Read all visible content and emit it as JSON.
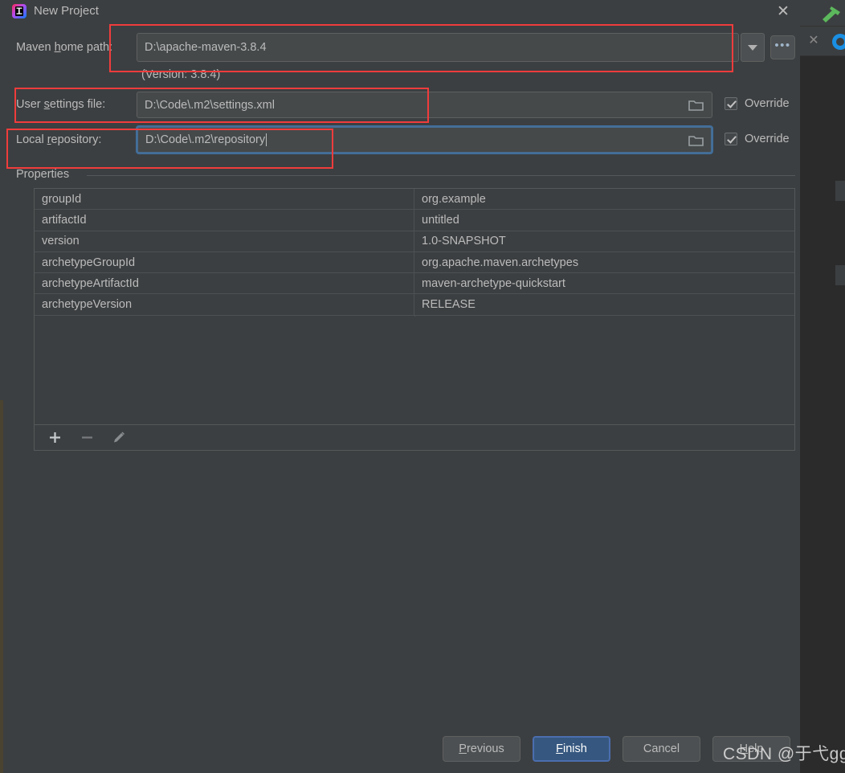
{
  "window": {
    "title": "New Project",
    "app_icon": "intellij-idea-icon",
    "close_label": "✕"
  },
  "form": {
    "maven_home": {
      "label_pre": "Maven ",
      "label_mnemonic": "h",
      "label_post": "ome path:",
      "value": "D:\\apache-maven-3.8.4",
      "dropdown_icon": "chevron-down-icon",
      "browse_label": "•••",
      "version_note": "(Version: 3.8.4)"
    },
    "user_settings": {
      "label_pre": "User ",
      "label_mnemonic": "s",
      "label_post": "ettings file:",
      "value": "D:\\Code\\.m2\\settings.xml",
      "browse_icon": "folder-icon",
      "override_label": "Override",
      "override_checked": true
    },
    "local_repository": {
      "label_pre": "Local ",
      "label_mnemonic": "r",
      "label_post": "epository:",
      "value": "D:\\Code\\.m2\\repository",
      "browse_icon": "folder-icon",
      "override_label": "Override",
      "override_checked": true,
      "focused": true
    }
  },
  "properties": {
    "section_label": "Properties",
    "rows": [
      {
        "key": "groupId",
        "value": "org.example"
      },
      {
        "key": "artifactId",
        "value": "untitled"
      },
      {
        "key": "version",
        "value": "1.0-SNAPSHOT"
      },
      {
        "key": "archetypeGroupId",
        "value": "org.apache.maven.archetypes"
      },
      {
        "key": "archetypeArtifactId",
        "value": "maven-archetype-quickstart"
      },
      {
        "key": "archetypeVersion",
        "value": "RELEASE"
      }
    ],
    "toolbar": {
      "add_icon": "plus-icon",
      "remove_icon": "minus-icon",
      "edit_icon": "pencil-icon"
    }
  },
  "footer": {
    "previous": {
      "pre": "",
      "mnemonic": "P",
      "post": "revious"
    },
    "finish": {
      "pre": "",
      "mnemonic": "F",
      "post": "inish"
    },
    "cancel": {
      "pre": "Cancel",
      "mnemonic": "",
      "post": ""
    },
    "help": {
      "pre": "",
      "mnemonic": "H",
      "post": "elp"
    }
  },
  "watermark": "CSDN @于弋gg",
  "colors": {
    "dialog_bg": "#3c3f41",
    "field_bg": "#45494a",
    "text": "#bbbbbb",
    "accent_primary": "#365880",
    "focus_border": "#466d94",
    "annotation_red": "#f03c3c"
  },
  "annotations": [
    {
      "name": "maven-home-path-highlight"
    },
    {
      "name": "user-settings-file-highlight"
    },
    {
      "name": "local-repository-highlight"
    }
  ]
}
